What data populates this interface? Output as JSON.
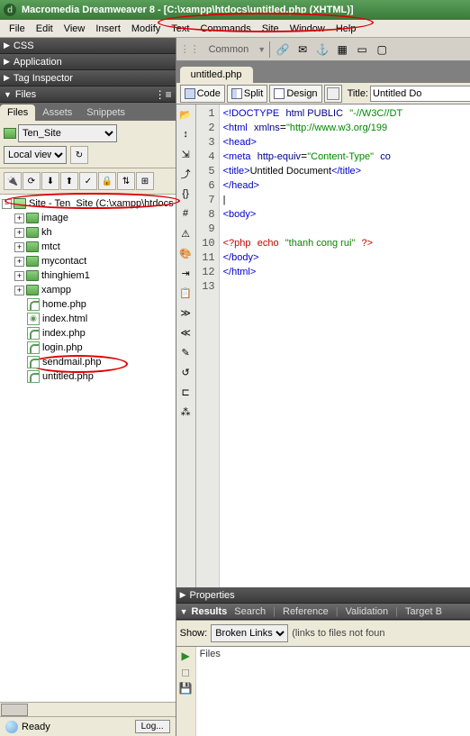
{
  "titlebar": {
    "app": "Macromedia Dreamweaver 8",
    "path": "[C:\\xampp\\htdocs\\untitled.php (XHTML)]"
  },
  "menubar": [
    "File",
    "Edit",
    "View",
    "Insert",
    "Modify",
    "Text",
    "Commands",
    "Site",
    "Window",
    "Help"
  ],
  "panels": {
    "css": "CSS",
    "application": "Application",
    "tag_inspector": "Tag Inspector",
    "files": "Files"
  },
  "files_panel": {
    "tabs": [
      "Files",
      "Assets",
      "Snippets"
    ],
    "site_select": "Ten_Site",
    "view_select": "Local view",
    "tree": {
      "root": "Site - Ten_Site (C:\\xampp\\htdocs",
      "folders": [
        "image",
        "kh",
        "mtct",
        "mycontact",
        "thinghiem1",
        "xampp"
      ],
      "files": [
        {
          "name": "home.php",
          "type": "php"
        },
        {
          "name": "index.html",
          "type": "html"
        },
        {
          "name": "index.php",
          "type": "php"
        },
        {
          "name": "login.php",
          "type": "php"
        },
        {
          "name": "sendmail.php",
          "type": "php"
        },
        {
          "name": "untitled.php",
          "type": "php"
        }
      ]
    }
  },
  "status": {
    "text": "Ready",
    "log_btn": "Log..."
  },
  "insert_bar": {
    "category": "Common"
  },
  "document": {
    "tab": "untitled.php",
    "views": {
      "code": "Code",
      "split": "Split",
      "design": "Design"
    },
    "title_label": "Title:",
    "title_value": "Untitled Do"
  },
  "code": {
    "lines": [
      {
        "n": 1,
        "html": "<span class='kw'>&lt;!DOCTYPE</span> <span class='tag'>html PUBLIC</span> <span class='str'>\"-//W3C//DT</span>"
      },
      {
        "n": 2,
        "html": "<span class='kw'>&lt;html</span> <span class='tag'>xmlns</span>=<span class='str'>\"http://www.w3.org/199</span>"
      },
      {
        "n": 3,
        "html": "<span class='kw'>&lt;head&gt;</span>"
      },
      {
        "n": 4,
        "html": "<span class='kw'>&lt;meta</span> <span class='tag'>http-equiv</span>=<span class='str'>\"Content-Type\"</span> <span class='tag'>co</span>"
      },
      {
        "n": 5,
        "html": "<span class='kw'>&lt;title&gt;</span><span class='txt'>Untitled Document</span><span class='kw'>&lt;/title&gt;</span>"
      },
      {
        "n": 6,
        "html": "<span class='kw'>&lt;/head&gt;</span>"
      },
      {
        "n": 7,
        "html": "<span class='txt'>|</span>"
      },
      {
        "n": 8,
        "html": "<span class='kw'>&lt;body&gt;</span>"
      },
      {
        "n": 9,
        "html": ""
      },
      {
        "n": 10,
        "html": "<span class='red'>&lt;?php</span> <span class='red'>echo</span> <span class='str'>\"thanh cong rui\"</span> <span class='red'>?&gt;</span>"
      },
      {
        "n": 11,
        "html": "<span class='kw'>&lt;/body&gt;</span>"
      },
      {
        "n": 12,
        "html": "<span class='kw'>&lt;/html&gt;</span>"
      },
      {
        "n": 13,
        "html": ""
      }
    ]
  },
  "properties": {
    "label": "Properties"
  },
  "results": {
    "label": "Results",
    "tabs": [
      "Search",
      "Reference",
      "Validation",
      "Target B"
    ],
    "show_label": "Show:",
    "show_value": "Broken Links",
    "hint": "(links to files not foun",
    "column": "Files"
  }
}
